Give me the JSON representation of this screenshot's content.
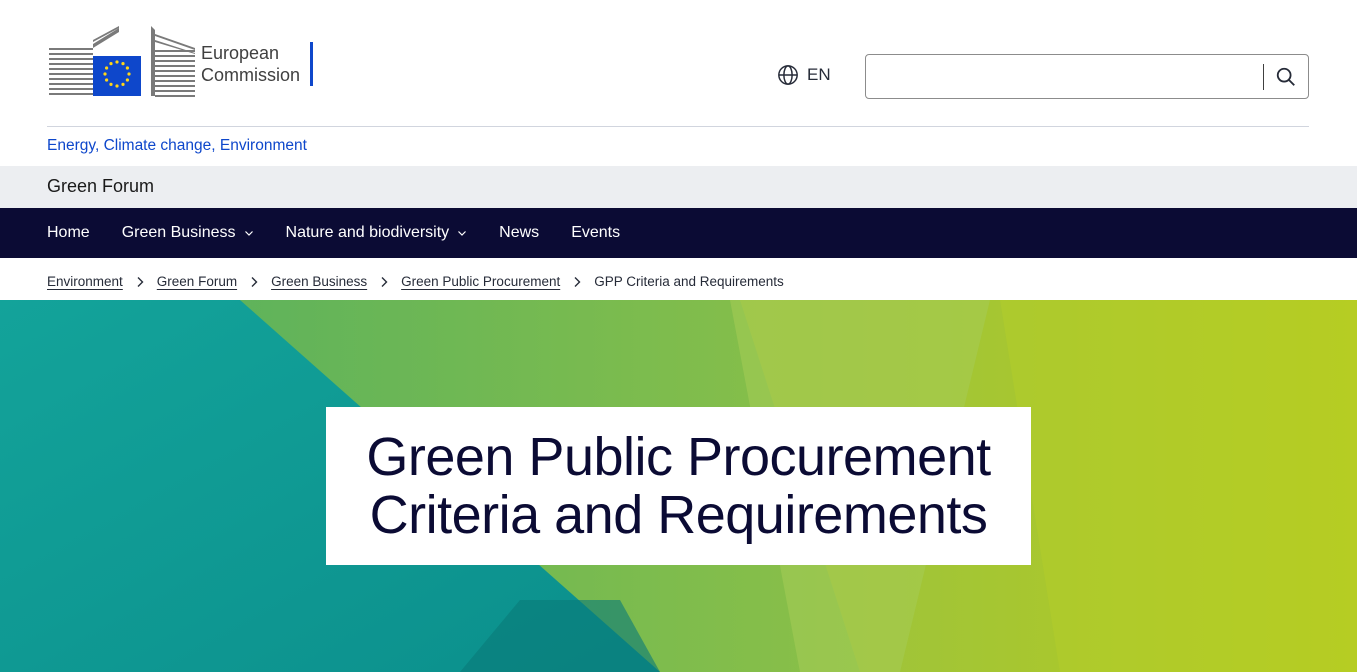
{
  "header": {
    "logo_line1": "European",
    "logo_line2": "Commission",
    "language": "EN",
    "language_icon": "globe-icon",
    "search_placeholder": "",
    "search_icon": "search-icon"
  },
  "site": {
    "parent_link": "Energy, Climate change, Environment",
    "name": "Green Forum"
  },
  "nav": {
    "items": [
      {
        "label": "Home",
        "has_dropdown": false
      },
      {
        "label": "Green Business",
        "has_dropdown": true
      },
      {
        "label": "Nature and biodiversity",
        "has_dropdown": true
      },
      {
        "label": "News",
        "has_dropdown": false
      },
      {
        "label": "Events",
        "has_dropdown": false
      }
    ]
  },
  "breadcrumb": {
    "items": [
      "Environment",
      "Green Forum",
      "Green Business",
      "Green Public Procurement"
    ],
    "current": "GPP Criteria and Requirements"
  },
  "hero": {
    "title_line1": "Green Public Procurement",
    "title_line2": "Criteria and Requirements"
  },
  "colors": {
    "brand_blue": "#0e47cb",
    "nav_bg": "#0b0b34",
    "site_bar_bg": "#eceef1",
    "hero_teal": "#0e9b96",
    "hero_green": "#7fbf4a",
    "hero_lime": "#b5cc1e"
  }
}
